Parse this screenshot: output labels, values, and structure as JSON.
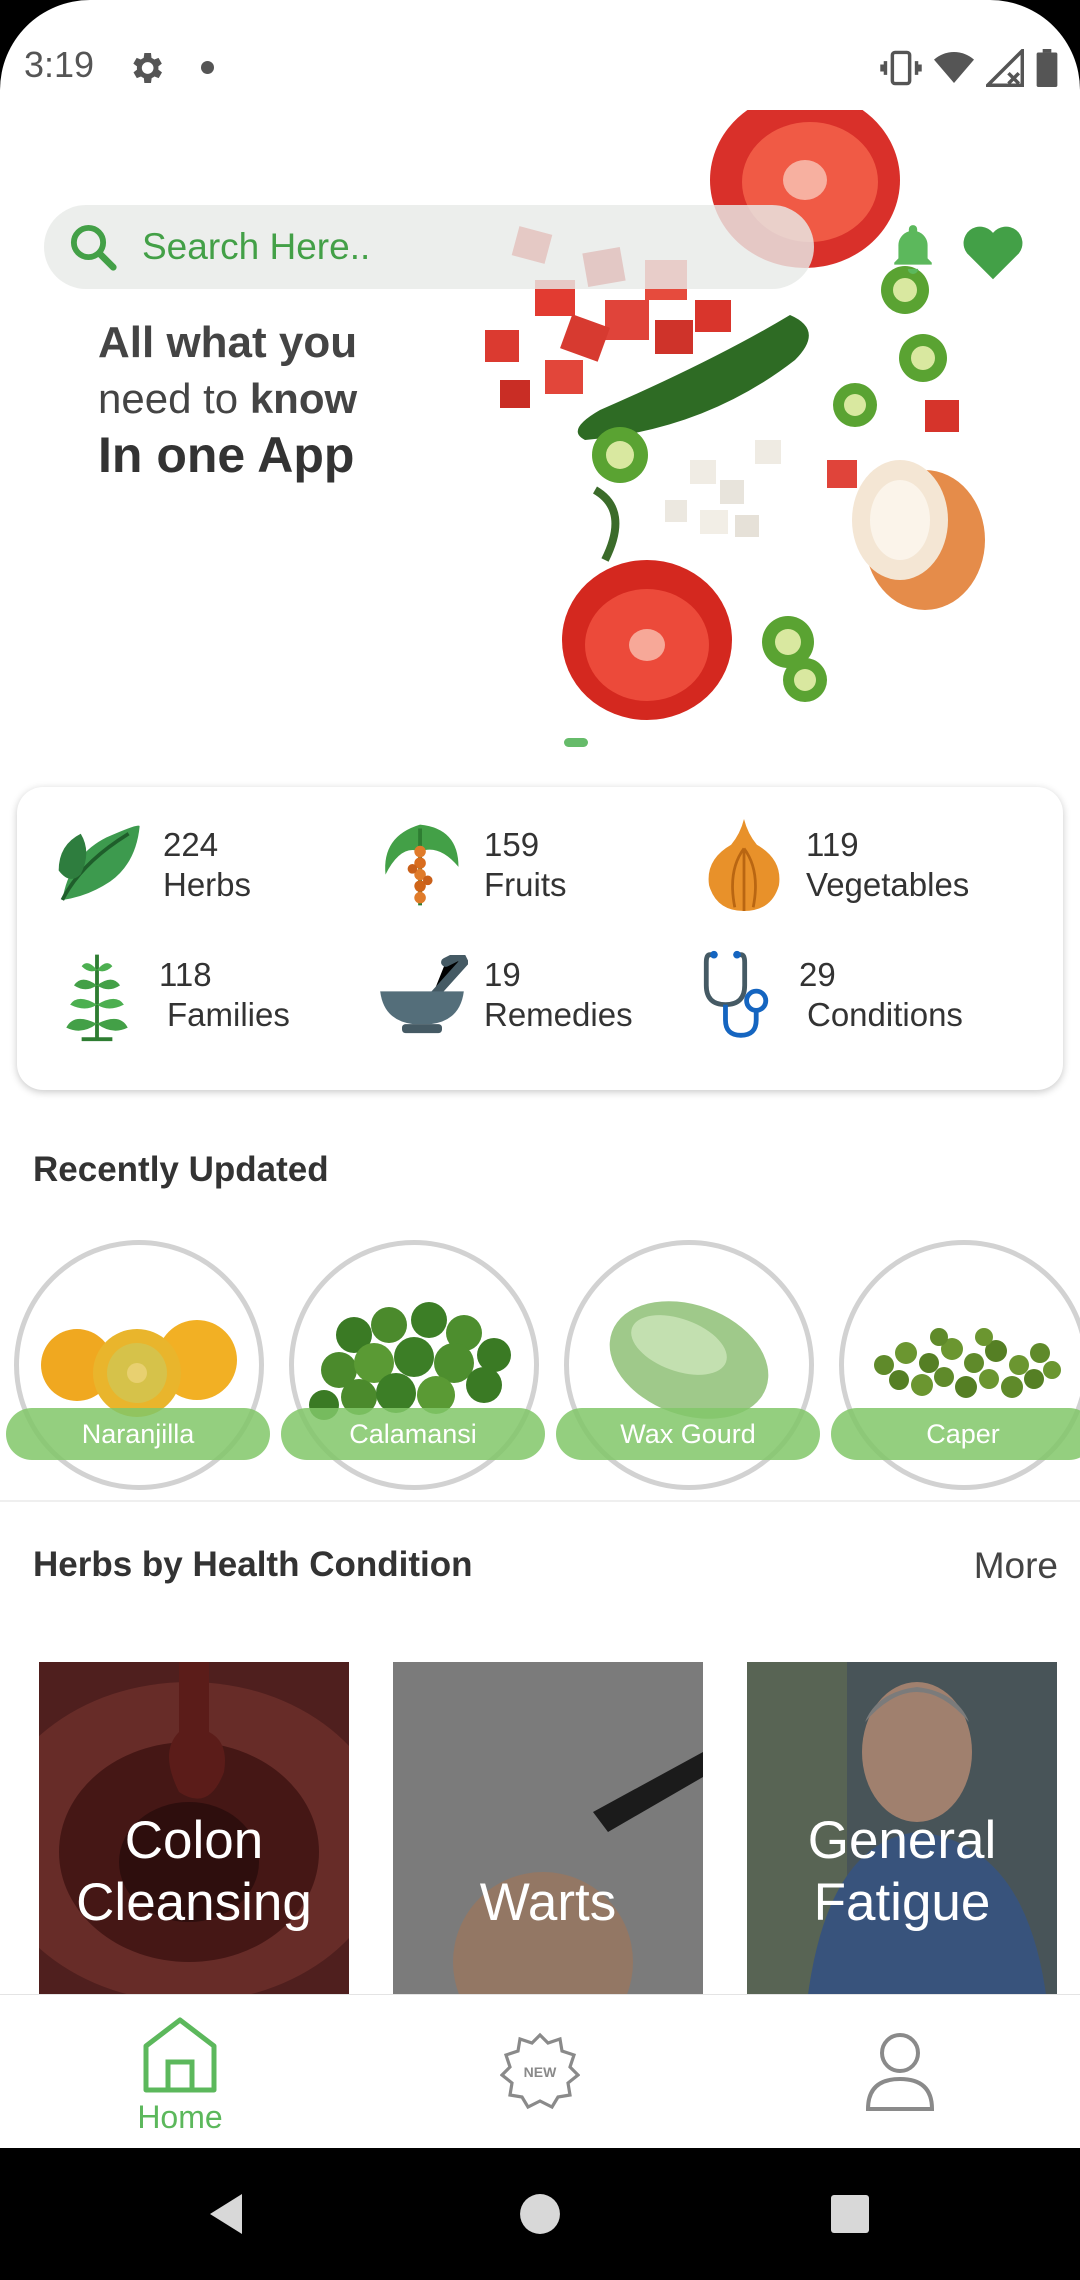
{
  "status_bar": {
    "time": "3:19"
  },
  "search": {
    "placeholder": "Search Here.."
  },
  "tagline": {
    "line1": "All what you",
    "line2_normal": "need to ",
    "line2_bold": "know",
    "line3": "In one App"
  },
  "stats": [
    {
      "count": "224",
      "label": "Herbs",
      "icon": "herb-leaf-icon"
    },
    {
      "count": "159",
      "label": "Fruits",
      "icon": "fruit-icon"
    },
    {
      "count": "119",
      "label": "Vegetables",
      "icon": "onion-icon"
    },
    {
      "count": "118",
      "label": "Families",
      "icon": "plant-icon"
    },
    {
      "count": "19",
      "label": "Remedies",
      "icon": "mortar-pestle-icon"
    },
    {
      "count": "29",
      "label": "Conditions",
      "icon": "stethoscope-icon"
    }
  ],
  "recently_updated": {
    "title": "Recently Updated",
    "items": [
      {
        "label": "Naranjilla"
      },
      {
        "label": "Calamansi"
      },
      {
        "label": "Wax Gourd"
      },
      {
        "label": "Caper"
      }
    ]
  },
  "health_conditions": {
    "title": "Herbs by Health Condition",
    "more": "More",
    "cards": [
      {
        "line1": "Colon",
        "line2": "Cleansing"
      },
      {
        "line1": "",
        "line2": "Warts"
      },
      {
        "line1": "General",
        "line2": "Fatigue"
      }
    ]
  },
  "bottom_nav": {
    "home": "Home"
  },
  "colors": {
    "accent_green": "#5cb85c",
    "search_green": "#43a047",
    "label_green": "#81c768"
  }
}
